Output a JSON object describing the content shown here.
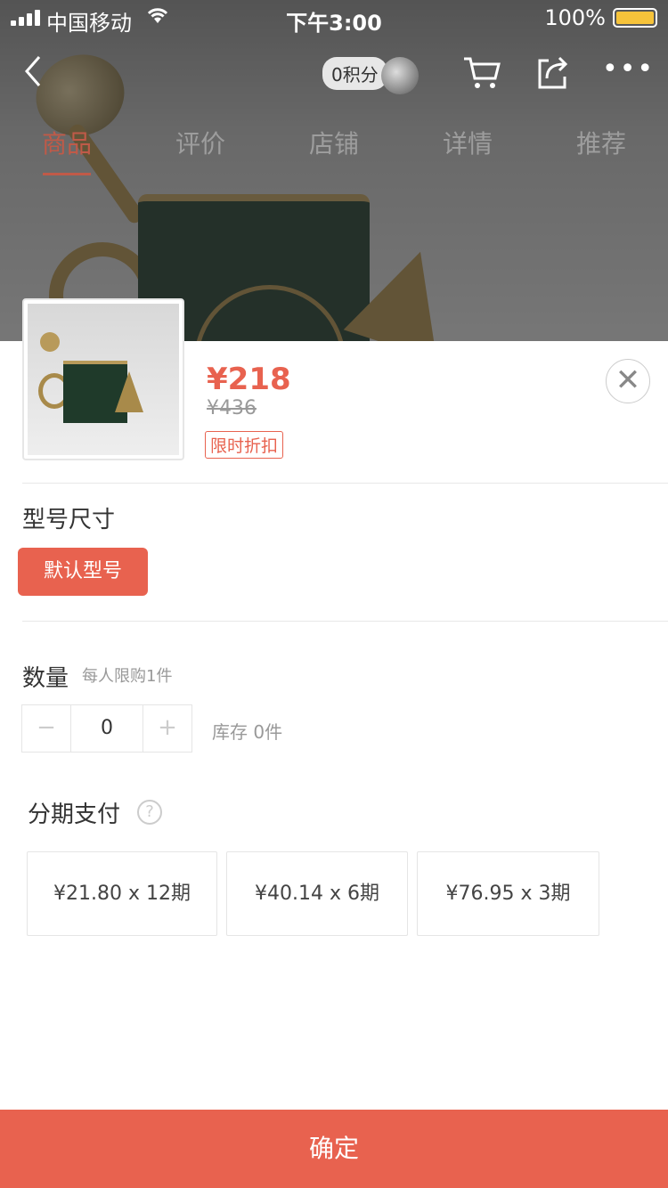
{
  "status_bar": {
    "carrier": "中国移动",
    "time": "下午3:00",
    "battery": "100%"
  },
  "nav": {
    "back_icon": "chevron-left-icon",
    "points": "0积分",
    "cart_icon": "cart-icon",
    "share_icon": "share-icon",
    "more_label": "•••"
  },
  "tabs": [
    {
      "label": "商品",
      "active": true
    },
    {
      "label": "评价",
      "active": false
    },
    {
      "label": "店铺",
      "active": false
    },
    {
      "label": "详情",
      "active": false
    },
    {
      "label": "推荐",
      "active": false
    }
  ],
  "product": {
    "price": "¥218",
    "original_price": "¥436",
    "discount_tag": "限时折扣"
  },
  "close_label": "✕",
  "spec": {
    "title": "型号尺寸",
    "selected": "默认型号"
  },
  "quantity": {
    "title": "数量",
    "limit_hint": "每人限购1件",
    "minus": "−",
    "value": "0",
    "plus": "+",
    "stock": "库存 0件"
  },
  "installment": {
    "title": "分期支付",
    "help": "?",
    "plans": [
      "¥21.80 x 12期",
      "¥40.14 x 6期",
      "¥76.95 x 3期"
    ]
  },
  "confirm_label": "确定",
  "colors": {
    "accent": "#e8624f"
  }
}
